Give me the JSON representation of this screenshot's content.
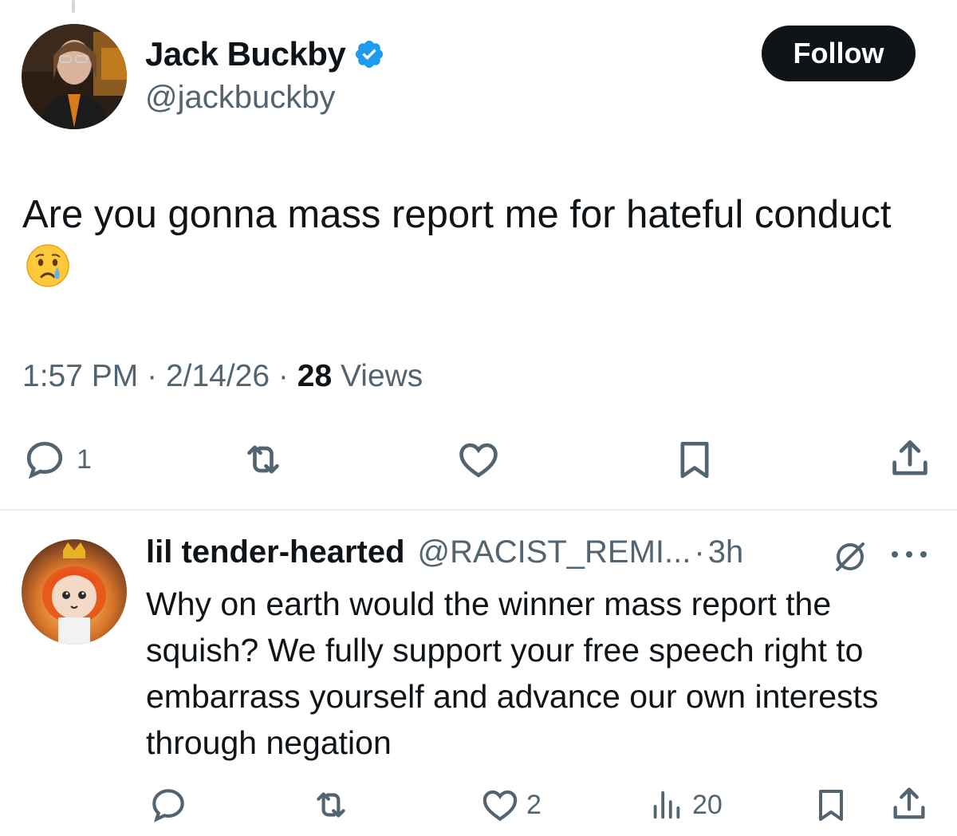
{
  "main_tweet": {
    "author_name": "Jack Buckby",
    "author_handle": "@jackbuckby",
    "follow_label": "Follow",
    "text": "Are you gonna mass report me for hateful conduct",
    "text_emoji": "crying-face",
    "time": "1:57 PM",
    "date": "2/14/26",
    "views_count": "28",
    "views_label": "Views",
    "separator": "·",
    "actions": {
      "reply_count": "1"
    }
  },
  "reply_tweet": {
    "author_name": "lil tender-hearted",
    "author_handle": "@RACIST_REMI...",
    "separator": "·",
    "time": "3h",
    "text": "Why on earth would the winner mass report the squish? We fully support your free speech right to embarrass yourself and advance our own interests through negation",
    "actions": {
      "like_count": "2",
      "views_count": "20"
    }
  },
  "colors": {
    "primary_text": "#0f1419",
    "secondary_text": "#536471",
    "verified_blue": "#1d9bf0",
    "follow_bg": "#0f1419",
    "divider": "#e6ecf0"
  },
  "icons": [
    "verified-badge-icon",
    "reply-icon",
    "retweet-icon",
    "like-icon",
    "bookmark-icon",
    "share-icon",
    "grok-icon",
    "more-icon",
    "views-icon"
  ]
}
